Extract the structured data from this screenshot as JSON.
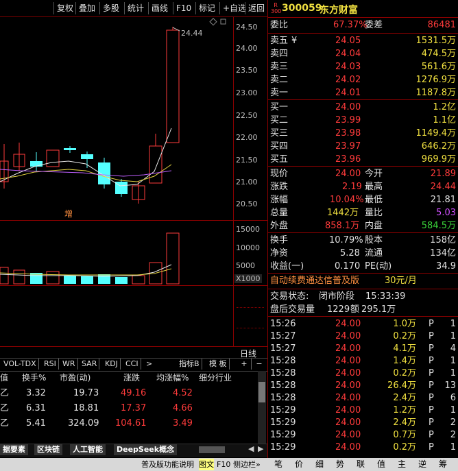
{
  "toolbar": [
    "复权",
    "叠加",
    "多股",
    "统计",
    "画线",
    "F10",
    "标记",
    "+自选",
    "返回"
  ],
  "chart": {
    "y_labels": [
      "24.50",
      "24.00",
      "23.50",
      "23.00",
      "22.50",
      "22.00",
      "21.50",
      "21.00",
      "20.50"
    ],
    "peak_label": "24.44",
    "marker": "增",
    "vol_labels": [
      "15000",
      "10000",
      "5000"
    ],
    "vol_unit": "X1000",
    "period": "日线"
  },
  "quote": {
    "badge_top": "R",
    "badge_bottom": "300",
    "code": "300059",
    "name": "东方财富",
    "weibi_label": "委比",
    "weibi": "67.37%",
    "weicha_label": "委差",
    "weicha": "86481",
    "sells": [
      {
        "label": "卖五",
        "mark": "¥",
        "price": "24.05",
        "vol": "1531.5万"
      },
      {
        "label": "卖四",
        "mark": "",
        "price": "24.04",
        "vol": "474.5万"
      },
      {
        "label": "卖三",
        "mark": "",
        "price": "24.03",
        "vol": "561.6万"
      },
      {
        "label": "卖二",
        "mark": "",
        "price": "24.02",
        "vol": "1276.9万"
      },
      {
        "label": "卖一",
        "mark": "",
        "price": "24.01",
        "vol": "1187.8万"
      }
    ],
    "buys": [
      {
        "label": "买一",
        "price": "24.00",
        "vol": "1.2亿"
      },
      {
        "label": "买二",
        "price": "23.99",
        "vol": "1.1亿"
      },
      {
        "label": "买三",
        "price": "23.98",
        "vol": "1149.4万"
      },
      {
        "label": "买四",
        "price": "23.97",
        "vol": "646.2万"
      },
      {
        "label": "买五",
        "price": "23.96",
        "vol": "969.9万"
      }
    ],
    "stats": [
      {
        "l1": "现价",
        "v1": "24.00",
        "l2": "今开",
        "v2": "21.89"
      },
      {
        "l1": "涨跌",
        "v1": "2.19",
        "l2": "最高",
        "v2": "24.44"
      },
      {
        "l1": "涨幅",
        "v1": "10.04%",
        "l2": "最低",
        "v2": "21.81"
      },
      {
        "l1": "总量",
        "v1": "1442万",
        "l2": "量比",
        "v2": "5.03"
      },
      {
        "l1": "外盘",
        "v1": "858.1万",
        "l2": "内盘",
        "v2": "584.5万"
      }
    ],
    "finance": [
      {
        "l1": "换手",
        "v1": "10.79%",
        "l2": "股本",
        "v2": "158亿"
      },
      {
        "l1": "净资",
        "v1": "5.28",
        "l2": "流通",
        "v2": "134亿"
      },
      {
        "l1": "收益(一)",
        "v1": "0.170",
        "l2": "PE(动)",
        "v2": "34.9"
      }
    ],
    "promo": "自动续费通达信普及版",
    "promo_price": "30元/月",
    "trade_state_label": "交易状态:",
    "trade_state": "闭市阶段",
    "trade_time": "15:33:39",
    "after_label": "盘后交易量",
    "after_vol": "1229",
    "after_amt_label": "额",
    "after_amt": "295.1万"
  },
  "ticks": [
    {
      "t": "15:26",
      "p": "24.00",
      "v": "1.0万",
      "f": "P",
      "n": "1"
    },
    {
      "t": "15:27",
      "p": "24.00",
      "v": "0.2万",
      "f": "P",
      "n": "1"
    },
    {
      "t": "15:27",
      "p": "24.00",
      "v": "4.1万",
      "f": "P",
      "n": "4"
    },
    {
      "t": "15:28",
      "p": "24.00",
      "v": "1.4万",
      "f": "P",
      "n": "1"
    },
    {
      "t": "15:28",
      "p": "24.00",
      "v": "0.2万",
      "f": "P",
      "n": "1"
    },
    {
      "t": "15:28",
      "p": "24.00",
      "v": "26.4万",
      "f": "P",
      "n": "13"
    },
    {
      "t": "15:28",
      "p": "24.00",
      "v": "2.4万",
      "f": "P",
      "n": "6"
    },
    {
      "t": "15:29",
      "p": "24.00",
      "v": "1.2万",
      "f": "P",
      "n": "1"
    },
    {
      "t": "15:29",
      "p": "24.00",
      "v": "2.4万",
      "f": "P",
      "n": "2"
    },
    {
      "t": "15:29",
      "p": "24.00",
      "v": "0.7万",
      "f": "P",
      "n": "2"
    },
    {
      "t": "15:29",
      "p": "24.00",
      "v": "0.2万",
      "f": "P",
      "n": "1"
    }
  ],
  "indicator_tabs": [
    "VOL-TDX",
    "RSI",
    "WR",
    "SAR",
    "KDJ",
    "CCI"
  ],
  "indicator_right": [
    "指标B",
    "模 板",
    "+",
    "−"
  ],
  "table": {
    "headers": [
      "值",
      "换手%",
      "市盈(动)",
      "涨跌",
      "均涨幅%",
      "细分行业"
    ],
    "rows": [
      {
        "a": "乙",
        "b": "3.32",
        "c": "19.73",
        "d": "49.16",
        "e": "4.52"
      },
      {
        "a": "乙",
        "b": "6.31",
        "c": "18.81",
        "d": "17.37",
        "e": "4.66"
      },
      {
        "a": "乙",
        "b": "5.41",
        "c": "324.09",
        "d": "104.61",
        "e": "3.49"
      }
    ]
  },
  "bottom_tabs": [
    "据要素",
    "区块链",
    "人工智能",
    "DeepSeek概念"
  ],
  "status": {
    "left": "普及版功能说明",
    "mid1": "图文",
    "mid2": "F10",
    "mid3": "侧边栏»"
  },
  "status_buttons": [
    "笔",
    "价",
    "细",
    "势",
    "联",
    "值",
    "主",
    "逆",
    "筹"
  ],
  "colors": {
    "up": "#ff3b3b",
    "down": "#54ffff",
    "border": "#8b0000"
  }
}
